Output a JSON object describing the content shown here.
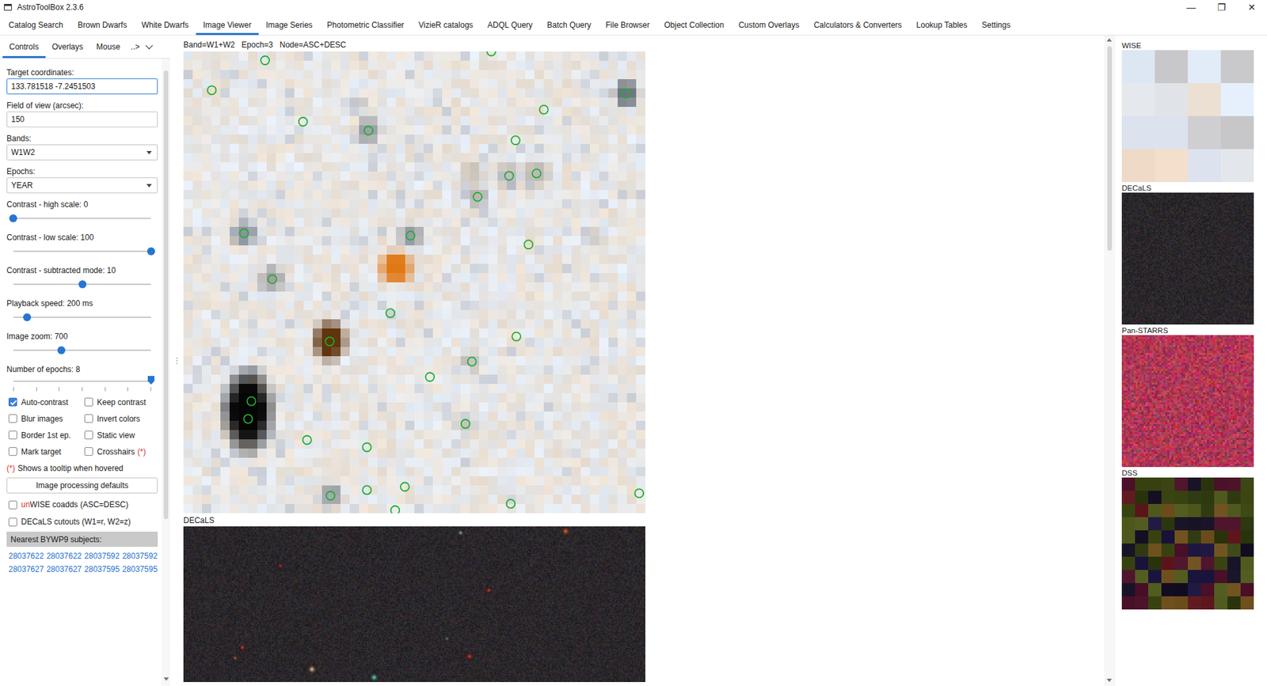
{
  "window": {
    "title": "AstroToolBox 2.3.6",
    "buttons": [
      "—",
      "❐",
      "✕"
    ]
  },
  "tabs": [
    {
      "label": "Catalog Search",
      "selected": false
    },
    {
      "label": "Brown Dwarfs",
      "selected": false
    },
    {
      "label": "White Dwarfs",
      "selected": false
    },
    {
      "label": "Image Viewer",
      "selected": true
    },
    {
      "label": "Image Series",
      "selected": false
    },
    {
      "label": "Photometric Classifier",
      "selected": false
    },
    {
      "label": "VizieR catalogs",
      "selected": false
    },
    {
      "label": "ADQL Query",
      "selected": false
    },
    {
      "label": "Batch Query",
      "selected": false
    },
    {
      "label": "File Browser",
      "selected": false
    },
    {
      "label": "Object Collection",
      "selected": false
    },
    {
      "label": "Custom Overlays",
      "selected": false
    },
    {
      "label": "Calculators & Converters",
      "selected": false
    },
    {
      "label": "Lookup Tables",
      "selected": false
    },
    {
      "label": "Settings",
      "selected": false
    }
  ],
  "left_panel": {
    "subtabs": [
      {
        "label": "Controls",
        "selected": true
      },
      {
        "label": "Overlays",
        "selected": false
      },
      {
        "label": "Mouse",
        "selected": false
      }
    ],
    "more": "..>",
    "fields": [
      {
        "label": "Target coordinates:",
        "value": "133.781518 -7.2451503",
        "kind": "text",
        "focused": true
      },
      {
        "label": "Field of view (arcsec):",
        "value": "150",
        "kind": "text",
        "focused": false
      },
      {
        "label": "Bands:",
        "value": "W1W2",
        "kind": "dropdown",
        "focused": false
      },
      {
        "label": "Epochs:",
        "value": "YEAR",
        "kind": "dropdown",
        "focused": false
      }
    ],
    "sliders": [
      {
        "label": "Contrast - high scale: 0",
        "level": 0,
        "kind": "plain"
      },
      {
        "label": "Contrast - low scale: 100",
        "level": 1,
        "kind": "plain"
      },
      {
        "label": "Contrast - subtracted mode: 10",
        "level": 0.5,
        "kind": "plain"
      },
      {
        "label": "Playback speed: 200 ms",
        "level": 0.1,
        "kind": "plain"
      },
      {
        "label": "Image zoom: 700",
        "level": 0.35,
        "kind": "plain"
      },
      {
        "label": "Number of epochs: 8",
        "level": 1,
        "kind": "ticked"
      }
    ],
    "checkboxes": [
      {
        "label": "Auto-contrast",
        "checked": true
      },
      {
        "label": "Keep contrast",
        "checked": false
      },
      {
        "label": "Blur images",
        "checked": false
      },
      {
        "label": "Invert colors",
        "checked": false
      },
      {
        "label": "Border 1st ep.",
        "checked": false
      },
      {
        "label": "Static view",
        "checked": false
      },
      {
        "label": "Mark target",
        "checked": false
      },
      {
        "label": "Crosshairs",
        "checked": false,
        "note": "(*)"
      }
    ],
    "hint": {
      "mark": "(*)",
      "text": "Shows a tooltip when hovered"
    },
    "defaults_button": "Image processing defaults",
    "options": [
      {
        "highlight": "un",
        "label": "WISE coadds (ASC=DESC)",
        "checked": false
      },
      {
        "label": "DECaLS cutouts (W1=r, W2=z)",
        "checked": false
      }
    ],
    "nearest": {
      "header": "Nearest BYWP9 subjects:",
      "links": [
        "28037622",
        "28037622",
        "28037592",
        "28037592",
        "28037627",
        "28037627",
        "28037595",
        "28037595"
      ]
    }
  },
  "viewer": {
    "info": [
      "Band=W1+W2",
      "Epoch=3",
      "Node=ASC+DESC"
    ],
    "secondary_label": "DECaLS"
  },
  "thumbnails": [
    "WISE",
    "DECaLS",
    "Pan-STARRS",
    "DSS"
  ]
}
